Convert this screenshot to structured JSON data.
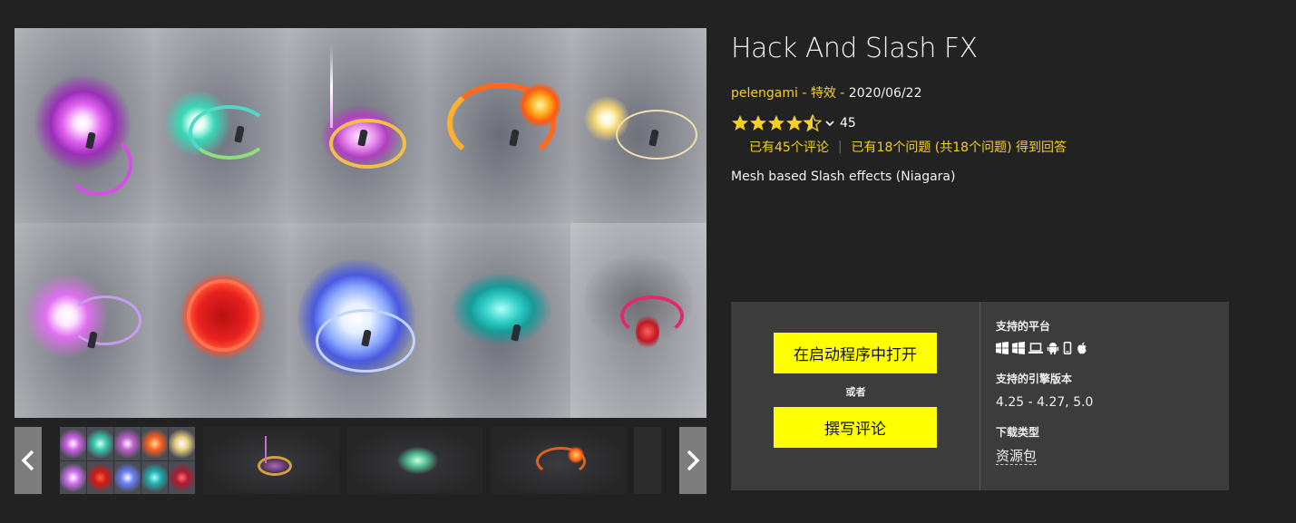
{
  "product": {
    "title": "Hack And Slash FX",
    "author": "pelengami",
    "separator": " - ",
    "category": "特效",
    "date": "2020/06/22",
    "rating": 4.5,
    "rating_count": "45",
    "reviews_text": "已有45个评论",
    "questions_text": "已有18个问题 (共18个问题) 得到回答",
    "description": "Mesh based Slash effects (Niagara)"
  },
  "actions": {
    "open_label": "在启动程序中打开",
    "or_label": "或者",
    "review_label": "撰写评论"
  },
  "details": {
    "platforms_label": "支持的平台",
    "platform_icons": [
      "windows-icon",
      "windows-icon",
      "laptop-icon",
      "android-icon",
      "mobile-icon",
      "apple-icon"
    ],
    "engine_label": "支持的引擎版本",
    "engine_versions": "4.25 - 4.27, 5.0",
    "download_label": "下载类型",
    "download_type": "资源包"
  },
  "colors": {
    "accent": "#f5d020",
    "button": "#ffff00",
    "panel": "#3c3c3c",
    "background": "#222222"
  }
}
